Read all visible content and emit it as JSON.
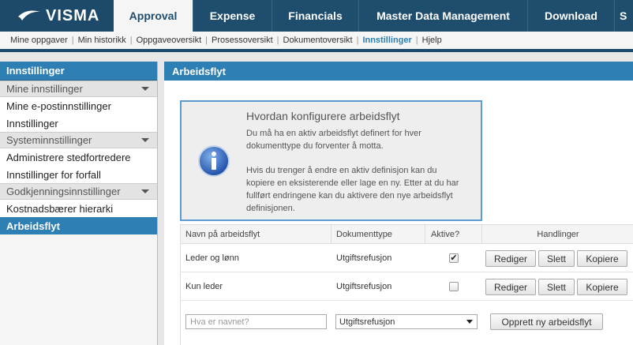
{
  "brand": {
    "name": "VISMA"
  },
  "top_tabs": [
    {
      "label": "Approval"
    },
    {
      "label": "Expense"
    },
    {
      "label": "Financials"
    },
    {
      "label": "Master Data Management"
    },
    {
      "label": "Download"
    },
    {
      "label": "S"
    }
  ],
  "sub_nav": [
    {
      "label": "Mine oppgaver"
    },
    {
      "label": "Min historikk"
    },
    {
      "label": "Oppgaveoversikt"
    },
    {
      "label": "Prosessoversikt"
    },
    {
      "label": "Dokumentoversikt"
    },
    {
      "label": "Innstillinger"
    },
    {
      "label": "Hjelp"
    }
  ],
  "sidebar": {
    "title": "Innstillinger",
    "groups": [
      {
        "label": "Mine innstillinger",
        "items": [
          {
            "label": "Mine e-postinnstillinger"
          },
          {
            "label": "Innstillinger"
          }
        ]
      },
      {
        "label": "Systeminnstillinger",
        "items": [
          {
            "label": "Administrere stedfortredere"
          },
          {
            "label": "Innstillinger for forfall"
          }
        ]
      },
      {
        "label": "Godkjenningsinnstillinger",
        "items": [
          {
            "label": "Kostnadsbærer hierarki"
          },
          {
            "label": "Arbeidsflyt"
          }
        ]
      }
    ]
  },
  "main": {
    "title": "Arbeidsflyt",
    "info": {
      "title": "Hvordan konfigurere arbeidsflyt",
      "p1_line1": "Du må ha en aktiv arbeidsflyt definert for hver",
      "p1_line2": "dokumenttype du forventer å motta.",
      "p2_line1": "Hvis du trenger å endre en aktiv definisjon kan du",
      "p2_line2": "kopiere en eksisterende eller lage en ny. Etter at du har",
      "p2_line3": "fullført endringene kan du aktivere den nye arbeidsflyt",
      "p2_line4": "definisjonen."
    },
    "table": {
      "headers": {
        "name": "Navn på arbeidsflyt",
        "doctype": "Dokumenttype",
        "active": "Aktive?",
        "actions": "Handlinger"
      },
      "rows": [
        {
          "name": "Leder og lønn",
          "doctype": "Utgiftsrefusjon",
          "active_mark": "✔"
        },
        {
          "name": "Kun leder",
          "doctype": "Utgiftsrefusjon",
          "active_mark": ""
        }
      ],
      "actions": {
        "edit": "Rediger",
        "delete": "Slett",
        "copy": "Kopiere"
      }
    },
    "create": {
      "name_placeholder": "Hva er navnet?",
      "doctype_value": "Utgiftsrefusjon",
      "button": "Opprett ny arbeidsflyt"
    }
  }
}
